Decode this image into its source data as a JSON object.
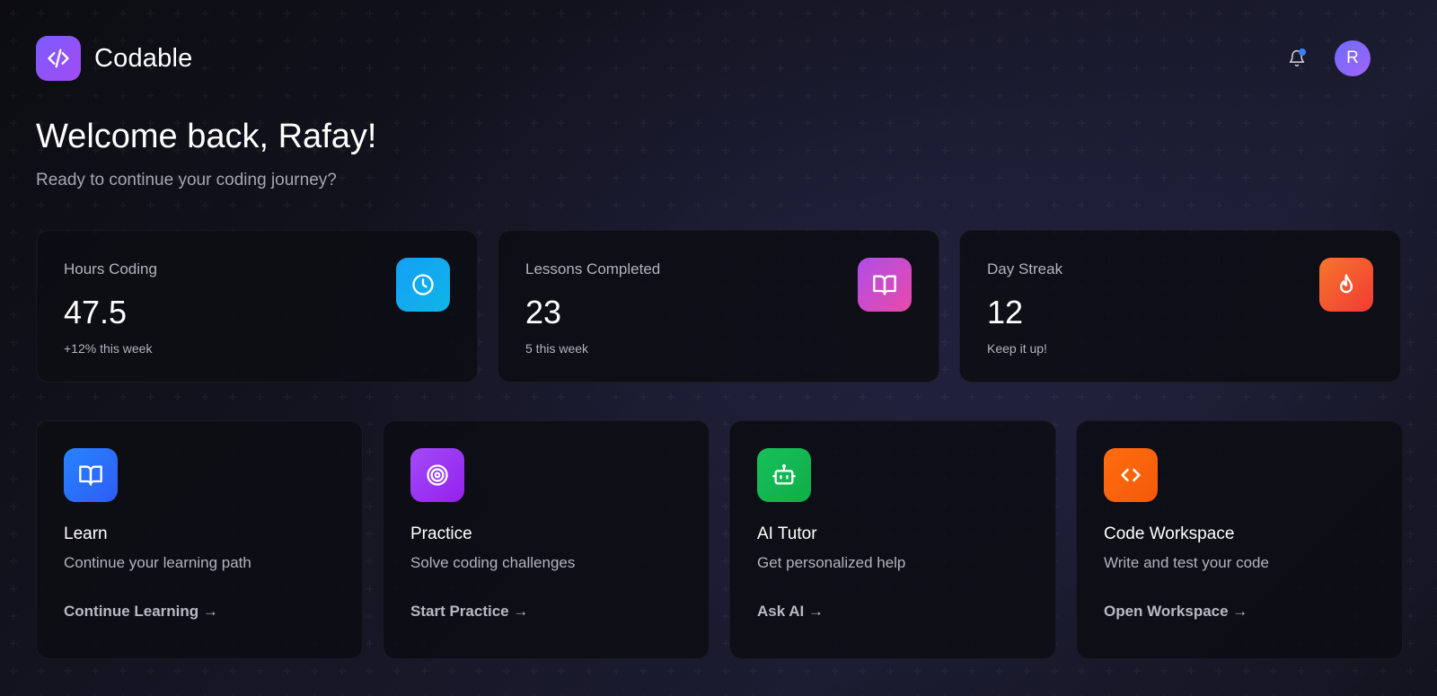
{
  "brand": {
    "name": "Codable",
    "logo_icon": "code-slash-icon"
  },
  "header": {
    "notification_icon": "bell-icon",
    "has_unread": true,
    "avatar_initial": "R"
  },
  "welcome": {
    "title": "Welcome back, Rafay!",
    "subtitle": "Ready to continue your coding journey?"
  },
  "stats": [
    {
      "label": "Hours Coding",
      "value": "47.5",
      "sub": "+12% this week",
      "icon": "clock-icon",
      "color": "#14a0f6"
    },
    {
      "label": "Lessons Completed",
      "value": "23",
      "sub": "5 this week",
      "icon": "book-icon",
      "color": "#c44bd0"
    },
    {
      "label": "Day Streak",
      "value": "12",
      "sub": "Keep it up!",
      "icon": "flame-icon",
      "color": "#f5582f"
    }
  ],
  "features": [
    {
      "title": "Learn",
      "description": "Continue your learning path",
      "link": "Continue Learning →",
      "icon": "book-icon",
      "color": "#2684ff"
    },
    {
      "title": "Practice",
      "description": "Solve coding challenges",
      "link": "Start Practice →",
      "icon": "target-icon",
      "color": "#a14bf7"
    },
    {
      "title": "AI Tutor",
      "description": "Get personalized help",
      "link": "Ask AI →",
      "icon": "robot-icon",
      "color": "#17c05a"
    },
    {
      "title": "Code Workspace",
      "description": "Write and test your code",
      "link": "Open Workspace →",
      "icon": "code-icon",
      "color": "#ff6d10"
    }
  ],
  "theme": {
    "background": "#13131d",
    "card": "#0d0d13",
    "text": "#ffffff",
    "muted": "#b3b3bf"
  }
}
